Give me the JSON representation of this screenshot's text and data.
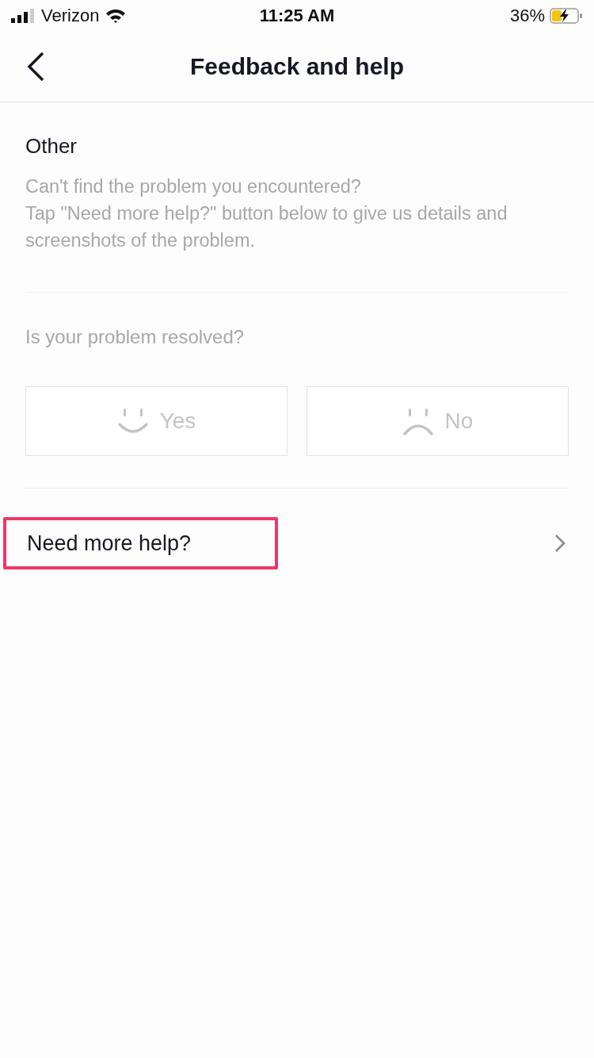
{
  "status_bar": {
    "carrier": "Verizon",
    "time": "11:25 AM",
    "battery": "36%",
    "charging": true
  },
  "header": {
    "title": "Feedback and help"
  },
  "section": {
    "title": "Other",
    "description": "Can't find the problem you encountered?\nTap \"Need more help?\" button below to give us details and screenshots of the problem."
  },
  "question": "Is your problem resolved?",
  "answers": [
    {
      "kind": "happy",
      "label": "Yes"
    },
    {
      "kind": "sad",
      "label": "No"
    }
  ],
  "more_help": {
    "label": "Need more help?",
    "highlighted": true
  }
}
